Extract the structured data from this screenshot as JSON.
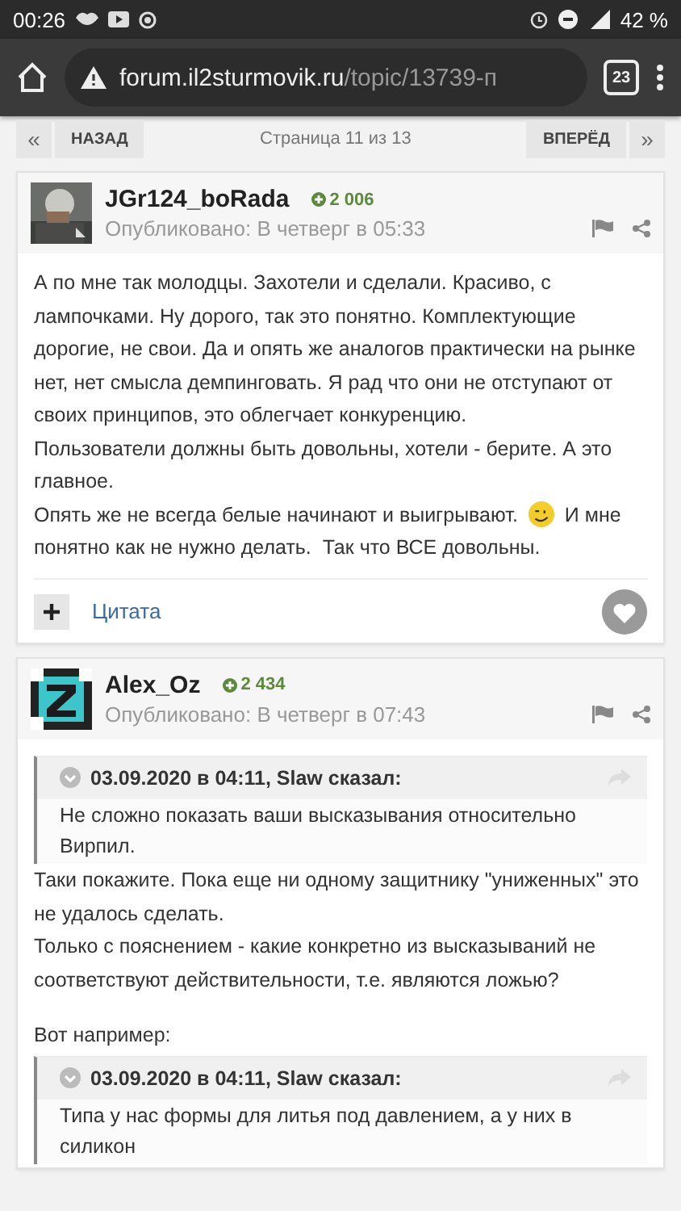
{
  "status_bar": {
    "time": "00:26",
    "battery": "42 %"
  },
  "browser": {
    "url_host": "forum.il2sturmovik.ru",
    "url_path": "/topic/13739-п",
    "tab_count": "23"
  },
  "pagination": {
    "first": "«",
    "prev": "НАЗАД",
    "page": "Страница 11 из 13",
    "next": "ВПЕРЁД",
    "last": "»"
  },
  "posts": [
    {
      "author": "JGr124_boRada",
      "reputation": "2 006",
      "published": "Опубликовано: В четверг в 05:33",
      "body": [
        {
          "kind": "text",
          "text": "А по мне так молодцы. Захотели и сделали. Красиво, с лампочками. Ну дорого, так это понятно. Комплектующие дорогие, не свои. Да и опять же аналогов практически на рынке нет, нет смысла демпинговать. Я рад что они не отступают от своих принципов, это облегчает конкуренцию."
        },
        {
          "kind": "text",
          "text": "Пользователи должны быть довольны, хотели - берите. А это главное."
        },
        {
          "kind": "emoji",
          "before": "Опять же не всегда белые начинают и выигрывают.",
          "after": "И мне",
          "continuation": "понятно как не нужно делать.  Так что ВСЕ довольны."
        }
      ],
      "footer": {
        "quote": "Цитата"
      }
    },
    {
      "author": "Alex_Oz",
      "reputation": "2 434",
      "published": "Опубликовано: В четверг в 07:43",
      "body": [
        {
          "kind": "quote",
          "citation": "03.09.2020 в 04:11, Slaw сказал:",
          "text": "Не сложно показать ваши высказывания относительно Вирпил."
        },
        {
          "kind": "text",
          "text": "Таки покажите. Пока еще ни одному защитнику \"униженных\" это не удалось сделать."
        },
        {
          "kind": "text",
          "text": "Только с пояснением - какие конкретно из высказываний не соответствуют действительности, т.е. являются ложью?"
        },
        {
          "kind": "spacer"
        },
        {
          "kind": "text",
          "text": "Вот например:"
        },
        {
          "kind": "quote",
          "citation": "03.09.2020 в 04:11, Slaw сказал:",
          "text": "Типа у нас формы для литья под давлением, а у них в силикон"
        }
      ]
    }
  ]
}
